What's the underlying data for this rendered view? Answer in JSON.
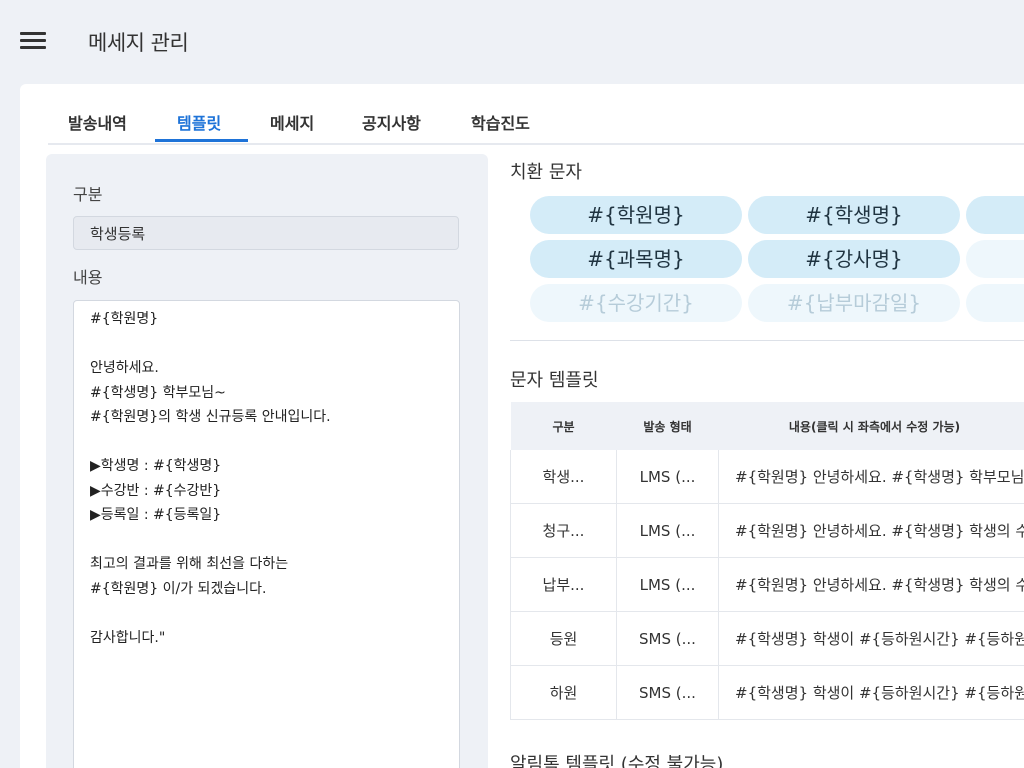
{
  "header": {
    "title": "메세지 관리"
  },
  "tabs": [
    {
      "label": "발송내역"
    },
    {
      "label": "템플릿"
    },
    {
      "label": "메세지"
    },
    {
      "label": "공지사항"
    },
    {
      "label": "학습진도"
    }
  ],
  "active_tab": "템플릿",
  "editor": {
    "category_label": "구분",
    "category_value": "학생등록",
    "content_label": "내용",
    "content_lines": [
      "#{학원명}",
      "",
      "안녕하세요.",
      "#{학생명} 학부모님~",
      "#{학원명}의 학생 신규등록 안내입니다.",
      "",
      "▶학생명 : #{학생명}",
      "▶수강반 : #{수강반}",
      "▶등록일 : #{등록일}",
      "",
      "최고의 결과를 위해 최선을 다하는",
      "#{학원명} 이/가 되겠습니다.",
      "",
      "감사합니다.\""
    ]
  },
  "placeholders": {
    "title": "치환 문자",
    "chips": [
      {
        "label": "#{학원명}",
        "enabled": true
      },
      {
        "label": "#{학생명}",
        "enabled": true
      },
      {
        "label": "#{",
        "enabled": true
      },
      {
        "label": "#{과목명}",
        "enabled": true
      },
      {
        "label": "#{강사명}",
        "enabled": true
      },
      {
        "label": "#{교",
        "enabled": false
      },
      {
        "label": "#{수강기간}",
        "enabled": false
      },
      {
        "label": "#{납부마감일}",
        "enabled": false
      },
      {
        "label": "#{",
        "enabled": false
      }
    ]
  },
  "sms_templates": {
    "title": "문자 템플릿",
    "columns": [
      "구분",
      "발송 형태",
      "내용(클릭 시 좌측에서 수정 가능)"
    ],
    "rows": [
      [
        "학생...",
        "LMS (...",
        "#{학원명} 안녕하세요. #{학생명} 학부모님~"
      ],
      [
        "청구...",
        "LMS (...",
        "#{학원명} 안녕하세요. #{학생명} 학생의 수강료"
      ],
      [
        "납부...",
        "LMS (...",
        "#{학원명} 안녕하세요. #{학생명} 학생의 수강료"
      ],
      [
        "등원",
        "SMS (...",
        "#{학생명} 학생이 #{등하원시간} #{등하원}"
      ],
      [
        "하원",
        "SMS (...",
        "#{학생명} 학생이 #{등하원시간} #{등하원}"
      ]
    ]
  },
  "alimtalk": {
    "title": "알림톡 템플릿 (수정 불가능)"
  },
  "colors": {
    "accent": "#1e73d8",
    "chip_active": "#d4ecf8",
    "chip_disabled": "#eef7fc",
    "background": "#eef1f6"
  },
  "icons": {
    "menu": "hamburger-menu-icon"
  }
}
